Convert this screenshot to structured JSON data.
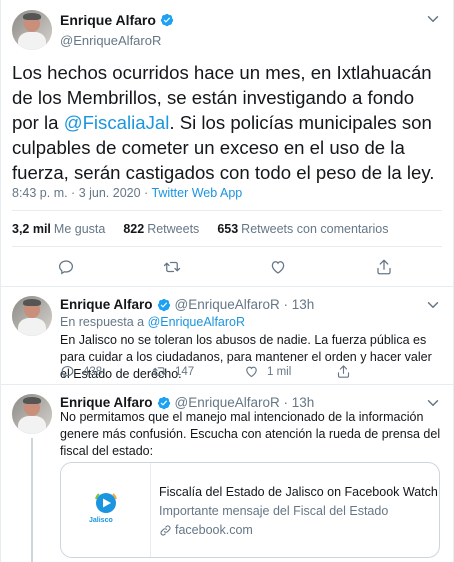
{
  "main_tweet": {
    "author_name": "Enrique Alfaro",
    "author_handle": "@EnriqueAlfaroR",
    "text_before_mention": "Los hechos ocurridos hace un mes, en Ixtlahuacán de los Membrillos, se están investigando a fondo por la ",
    "mention": "@FiscaliaJal",
    "text_after_mention": ". Si los policías municipales son culpables de cometer un exceso en el uso de la fuerza, serán castigados con todo el peso de la ley.",
    "timestamp": "8:43 p. m. · 3 jun. 2020 · ",
    "source_app": "Twitter Web App",
    "likes_count": "3,2 mil",
    "likes_label": "Me gusta",
    "retweets_count": "822",
    "retweets_label": "Retweets",
    "quotes_count": "653",
    "quotes_label": "Retweets con comentarios"
  },
  "replies": [
    {
      "author_name": "Enrique Alfaro",
      "author_handle": "@EnriqueAlfaroR · 13h",
      "in_reply_prefix": "En respuesta a ",
      "in_reply_handle": "@EnriqueAlfaroR",
      "text": "En Jalisco no se toleran los abusos de nadie. La fuerza pública es para cuidar a los ciudadanos, para mantener el orden y hacer valer el Estado de derecho.",
      "reply_count": "438",
      "retweet_count": "147",
      "like_count": "1 mil"
    },
    {
      "author_name": "Enrique Alfaro",
      "author_handle": "@EnriqueAlfaroR · 13h",
      "text": "No permitamos que el manejo mal intencionado de la información genere más confusión. Escucha con atención la rueda de prensa del fiscal del estado:"
    }
  ],
  "card": {
    "title": "Fiscalía del Estado de Jalisco on Facebook Watch",
    "description": "Importante mensaje del Fiscal del Estado",
    "domain": "facebook.com",
    "logo_text": "Jalisco"
  },
  "colors": {
    "accent": "#1b95e0",
    "secondary_text": "#657786",
    "divider": "#e6ecf0"
  },
  "icons": [
    "verified-badge-icon",
    "chevron-down-icon",
    "reply-icon",
    "retweet-icon",
    "like-icon",
    "share-icon",
    "link-icon",
    "play-icon"
  ]
}
